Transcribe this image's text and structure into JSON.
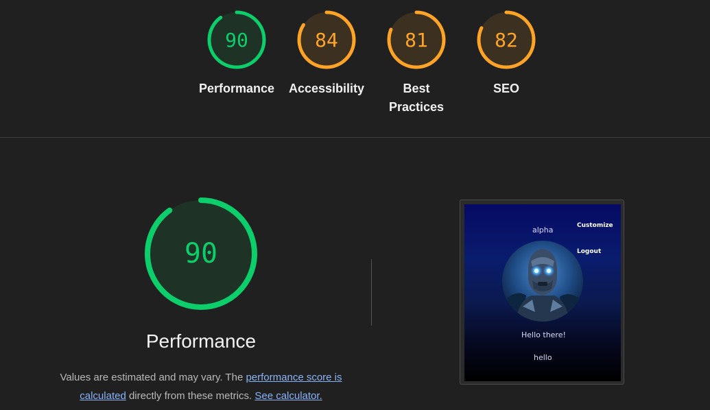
{
  "colors": {
    "pass": "#0cce6b",
    "pass_fill": "#1e3326",
    "average": "#ffa426",
    "average_fill": "#3c3121",
    "track": "#202020"
  },
  "categories": [
    {
      "label": "Performance",
      "score": "90",
      "value": 90,
      "rating": "pass"
    },
    {
      "label": "Accessibility",
      "score": "84",
      "value": 84,
      "rating": "average"
    },
    {
      "label": "Best Practices",
      "score": "81",
      "value": 81,
      "rating": "average"
    },
    {
      "label": "SEO",
      "score": "82",
      "value": 82,
      "rating": "average"
    }
  ],
  "performance": {
    "score": "90",
    "value": 90,
    "title": "Performance",
    "note_prefix": "Values are estimated and may vary. The ",
    "score_link": "performance score is calculated",
    "note_middle": " directly from these metrics. ",
    "calculator_link": "See calculator."
  },
  "screenshot": {
    "username": "alpha",
    "customize_label": "Customize",
    "logout_label": "Logout",
    "greeting": "Hello there!",
    "bio": "hello"
  }
}
